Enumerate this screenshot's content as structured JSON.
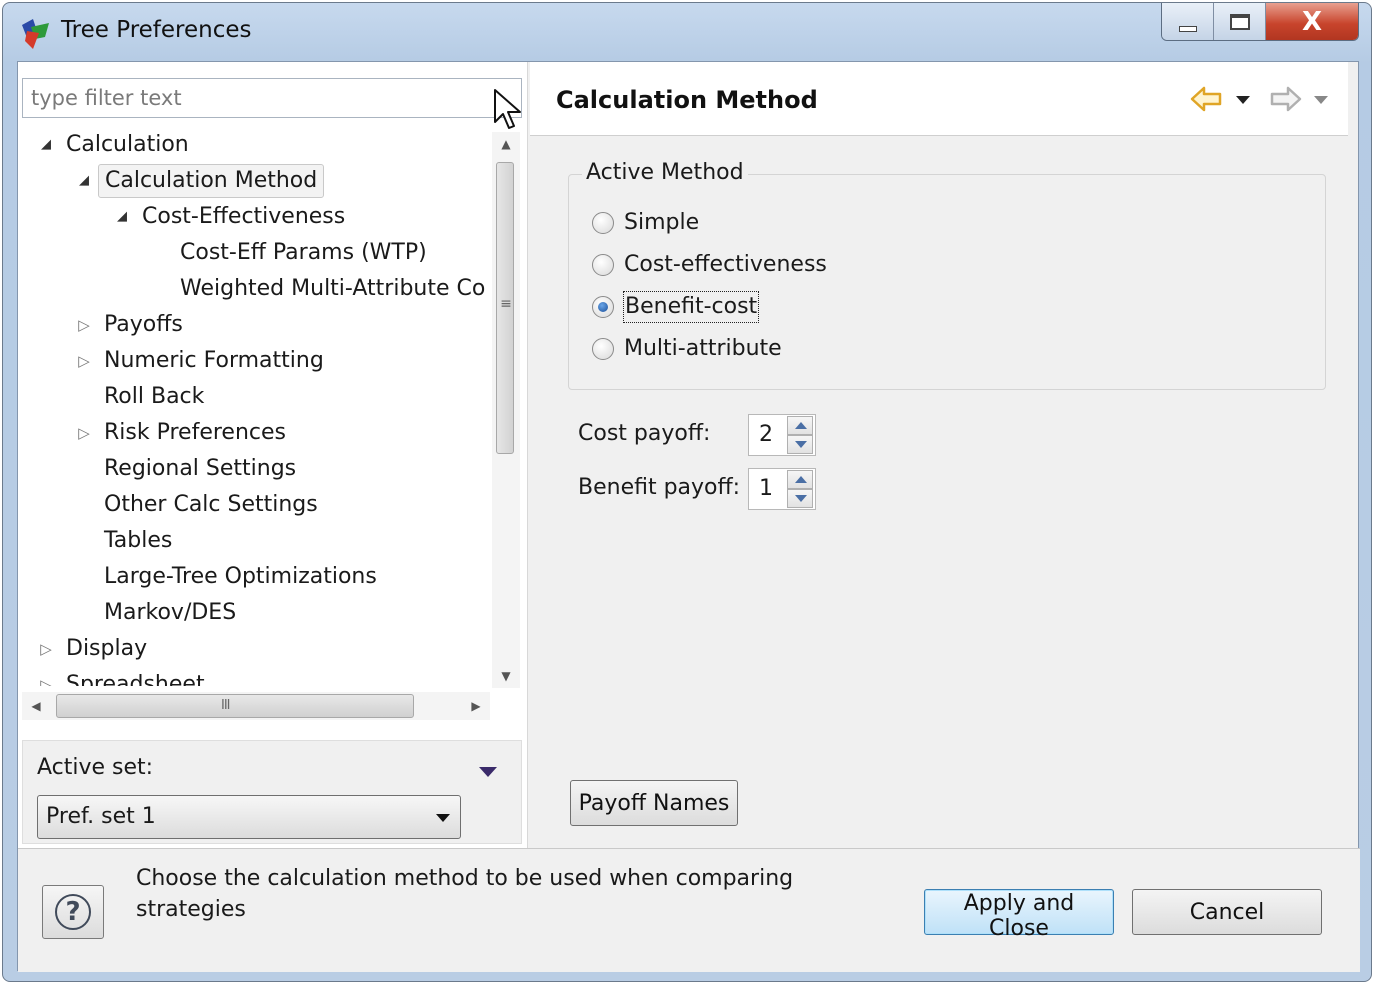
{
  "window": {
    "title": "Tree Preferences",
    "controls": {
      "minimize": "—",
      "maximize": "□",
      "close": "X"
    }
  },
  "filter": {
    "placeholder": "type filter text",
    "value": ""
  },
  "tree": {
    "items": [
      {
        "label": "Calculation",
        "level": 0,
        "state": "expanded"
      },
      {
        "label": "Calculation Method",
        "level": 1,
        "state": "expanded",
        "selected": true
      },
      {
        "label": "Cost-Effectiveness",
        "level": 2,
        "state": "expanded"
      },
      {
        "label": "Cost-Eff Params (WTP)",
        "level": 3,
        "state": "leaf"
      },
      {
        "label": "Weighted Multi-Attribute Co",
        "level": 3,
        "state": "leaf"
      },
      {
        "label": "Payoffs",
        "level": 1,
        "state": "collapsed"
      },
      {
        "label": "Numeric Formatting",
        "level": 1,
        "state": "collapsed"
      },
      {
        "label": "Roll Back",
        "level": 1,
        "state": "leaf"
      },
      {
        "label": "Risk Preferences",
        "level": 1,
        "state": "collapsed"
      },
      {
        "label": "Regional Settings",
        "level": 1,
        "state": "leaf"
      },
      {
        "label": "Other Calc Settings",
        "level": 1,
        "state": "leaf"
      },
      {
        "label": "Tables",
        "level": 1,
        "state": "leaf"
      },
      {
        "label": "Large-Tree Optimizations",
        "level": 1,
        "state": "leaf"
      },
      {
        "label": "Markov/DES",
        "level": 1,
        "state": "leaf"
      },
      {
        "label": "Display",
        "level": 0,
        "state": "collapsed"
      },
      {
        "label": "Spreadsheet",
        "level": 0,
        "state": "collapsed"
      }
    ],
    "scroll_grip_v": "≡",
    "scroll_grip_h": "III"
  },
  "active_set": {
    "label": "Active set:",
    "selected": "Pref. set 1"
  },
  "page": {
    "title": "Calculation Method",
    "group_title": "Active Method",
    "methods": [
      {
        "label": "Simple",
        "checked": false
      },
      {
        "label": "Cost-effectiveness",
        "checked": false
      },
      {
        "label": "Benefit-cost",
        "checked": true
      },
      {
        "label": "Multi-attribute",
        "checked": false
      }
    ],
    "cost_payoff": {
      "label": "Cost payoff:",
      "value": "2"
    },
    "benefit_payoff": {
      "label": "Benefit payoff:",
      "value": "1"
    },
    "payoff_names_label": "Payoff Names"
  },
  "footer": {
    "help_symbol": "?",
    "message": "Choose the calculation method to be used when comparing strategies",
    "apply_label": "Apply and Close",
    "cancel_label": "Cancel"
  },
  "colors": {
    "accent_focus": "#3c7fb1",
    "nav_back_arrow": "#e0a526",
    "radio_checked": "#1b4f9a"
  },
  "icons": {
    "app": "tree-app-icon",
    "cursor": "mouse-pointer-icon",
    "back": "back-arrow-icon",
    "forward": "forward-arrow-icon",
    "help": "help-icon"
  }
}
